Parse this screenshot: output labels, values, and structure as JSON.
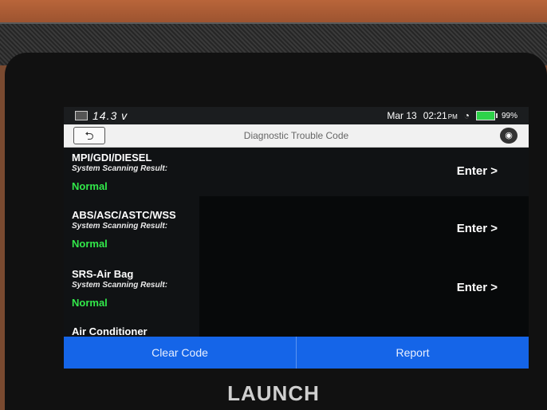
{
  "status_bar": {
    "voltage": "14.3 v",
    "date": "Mar 13",
    "time": "02:21",
    "time_suffix": "PM",
    "battery": "99%"
  },
  "header": {
    "title": "Diagnostic Trouble Code"
  },
  "systems": [
    {
      "name": "MPI/GDI/DIESEL",
      "result_label": "System Scanning Result:",
      "status": "Normal",
      "action": "Enter >"
    },
    {
      "name": "ABS/ASC/ASTC/WSS",
      "result_label": "System Scanning Result:",
      "status": "Normal",
      "action": "Enter >"
    },
    {
      "name": "SRS-Air Bag",
      "result_label": "System Scanning Result:",
      "status": "Normal",
      "action": "Enter >"
    },
    {
      "name": "Air Conditioner"
    }
  ],
  "actions": {
    "clear_code": "Clear Code",
    "report": "Report"
  },
  "device": {
    "brand": "LAUNCH"
  },
  "colors": {
    "normal_status": "#32e84a",
    "action_bar": "#1565e8",
    "battery": "#2ed24a"
  }
}
